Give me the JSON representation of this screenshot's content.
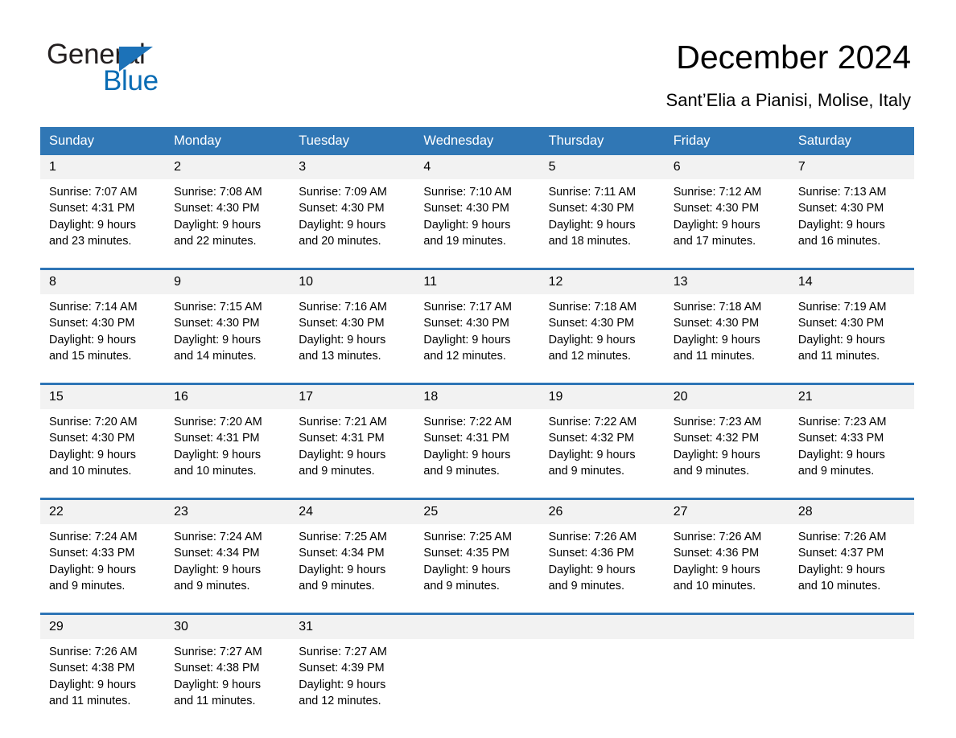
{
  "brand": {
    "name_part1": "General",
    "name_part2": "Blue",
    "accent_color": "#0a6cb4",
    "triangle_color": "#1c72b8"
  },
  "header": {
    "month_title": "December 2024",
    "location": "Sant’Elia a Pianisi, Molise, Italy"
  },
  "calendar": {
    "header_bg": "#3077b5",
    "date_strip_bg": "#f2f2f2",
    "row_divider_color": "#2e75b6",
    "weekday_headers": [
      "Sunday",
      "Monday",
      "Tuesday",
      "Wednesday",
      "Thursday",
      "Friday",
      "Saturday"
    ],
    "weeks": [
      [
        {
          "date": "1",
          "sunrise": "Sunrise: 7:07 AM",
          "sunset": "Sunset: 4:31 PM",
          "daylight_line1": "Daylight: 9 hours",
          "daylight_line2": "and 23 minutes."
        },
        {
          "date": "2",
          "sunrise": "Sunrise: 7:08 AM",
          "sunset": "Sunset: 4:30 PM",
          "daylight_line1": "Daylight: 9 hours",
          "daylight_line2": "and 22 minutes."
        },
        {
          "date": "3",
          "sunrise": "Sunrise: 7:09 AM",
          "sunset": "Sunset: 4:30 PM",
          "daylight_line1": "Daylight: 9 hours",
          "daylight_line2": "and 20 minutes."
        },
        {
          "date": "4",
          "sunrise": "Sunrise: 7:10 AM",
          "sunset": "Sunset: 4:30 PM",
          "daylight_line1": "Daylight: 9 hours",
          "daylight_line2": "and 19 minutes."
        },
        {
          "date": "5",
          "sunrise": "Sunrise: 7:11 AM",
          "sunset": "Sunset: 4:30 PM",
          "daylight_line1": "Daylight: 9 hours",
          "daylight_line2": "and 18 minutes."
        },
        {
          "date": "6",
          "sunrise": "Sunrise: 7:12 AM",
          "sunset": "Sunset: 4:30 PM",
          "daylight_line1": "Daylight: 9 hours",
          "daylight_line2": "and 17 minutes."
        },
        {
          "date": "7",
          "sunrise": "Sunrise: 7:13 AM",
          "sunset": "Sunset: 4:30 PM",
          "daylight_line1": "Daylight: 9 hours",
          "daylight_line2": "and 16 minutes."
        }
      ],
      [
        {
          "date": "8",
          "sunrise": "Sunrise: 7:14 AM",
          "sunset": "Sunset: 4:30 PM",
          "daylight_line1": "Daylight: 9 hours",
          "daylight_line2": "and 15 minutes."
        },
        {
          "date": "9",
          "sunrise": "Sunrise: 7:15 AM",
          "sunset": "Sunset: 4:30 PM",
          "daylight_line1": "Daylight: 9 hours",
          "daylight_line2": "and 14 minutes."
        },
        {
          "date": "10",
          "sunrise": "Sunrise: 7:16 AM",
          "sunset": "Sunset: 4:30 PM",
          "daylight_line1": "Daylight: 9 hours",
          "daylight_line2": "and 13 minutes."
        },
        {
          "date": "11",
          "sunrise": "Sunrise: 7:17 AM",
          "sunset": "Sunset: 4:30 PM",
          "daylight_line1": "Daylight: 9 hours",
          "daylight_line2": "and 12 minutes."
        },
        {
          "date": "12",
          "sunrise": "Sunrise: 7:18 AM",
          "sunset": "Sunset: 4:30 PM",
          "daylight_line1": "Daylight: 9 hours",
          "daylight_line2": "and 12 minutes."
        },
        {
          "date": "13",
          "sunrise": "Sunrise: 7:18 AM",
          "sunset": "Sunset: 4:30 PM",
          "daylight_line1": "Daylight: 9 hours",
          "daylight_line2": "and 11 minutes."
        },
        {
          "date": "14",
          "sunrise": "Sunrise: 7:19 AM",
          "sunset": "Sunset: 4:30 PM",
          "daylight_line1": "Daylight: 9 hours",
          "daylight_line2": "and 11 minutes."
        }
      ],
      [
        {
          "date": "15",
          "sunrise": "Sunrise: 7:20 AM",
          "sunset": "Sunset: 4:30 PM",
          "daylight_line1": "Daylight: 9 hours",
          "daylight_line2": "and 10 minutes."
        },
        {
          "date": "16",
          "sunrise": "Sunrise: 7:20 AM",
          "sunset": "Sunset: 4:31 PM",
          "daylight_line1": "Daylight: 9 hours",
          "daylight_line2": "and 10 minutes."
        },
        {
          "date": "17",
          "sunrise": "Sunrise: 7:21 AM",
          "sunset": "Sunset: 4:31 PM",
          "daylight_line1": "Daylight: 9 hours",
          "daylight_line2": "and 9 minutes."
        },
        {
          "date": "18",
          "sunrise": "Sunrise: 7:22 AM",
          "sunset": "Sunset: 4:31 PM",
          "daylight_line1": "Daylight: 9 hours",
          "daylight_line2": "and 9 minutes."
        },
        {
          "date": "19",
          "sunrise": "Sunrise: 7:22 AM",
          "sunset": "Sunset: 4:32 PM",
          "daylight_line1": "Daylight: 9 hours",
          "daylight_line2": "and 9 minutes."
        },
        {
          "date": "20",
          "sunrise": "Sunrise: 7:23 AM",
          "sunset": "Sunset: 4:32 PM",
          "daylight_line1": "Daylight: 9 hours",
          "daylight_line2": "and 9 minutes."
        },
        {
          "date": "21",
          "sunrise": "Sunrise: 7:23 AM",
          "sunset": "Sunset: 4:33 PM",
          "daylight_line1": "Daylight: 9 hours",
          "daylight_line2": "and 9 minutes."
        }
      ],
      [
        {
          "date": "22",
          "sunrise": "Sunrise: 7:24 AM",
          "sunset": "Sunset: 4:33 PM",
          "daylight_line1": "Daylight: 9 hours",
          "daylight_line2": "and 9 minutes."
        },
        {
          "date": "23",
          "sunrise": "Sunrise: 7:24 AM",
          "sunset": "Sunset: 4:34 PM",
          "daylight_line1": "Daylight: 9 hours",
          "daylight_line2": "and 9 minutes."
        },
        {
          "date": "24",
          "sunrise": "Sunrise: 7:25 AM",
          "sunset": "Sunset: 4:34 PM",
          "daylight_line1": "Daylight: 9 hours",
          "daylight_line2": "and 9 minutes."
        },
        {
          "date": "25",
          "sunrise": "Sunrise: 7:25 AM",
          "sunset": "Sunset: 4:35 PM",
          "daylight_line1": "Daylight: 9 hours",
          "daylight_line2": "and 9 minutes."
        },
        {
          "date": "26",
          "sunrise": "Sunrise: 7:26 AM",
          "sunset": "Sunset: 4:36 PM",
          "daylight_line1": "Daylight: 9 hours",
          "daylight_line2": "and 9 minutes."
        },
        {
          "date": "27",
          "sunrise": "Sunrise: 7:26 AM",
          "sunset": "Sunset: 4:36 PM",
          "daylight_line1": "Daylight: 9 hours",
          "daylight_line2": "and 10 minutes."
        },
        {
          "date": "28",
          "sunrise": "Sunrise: 7:26 AM",
          "sunset": "Sunset: 4:37 PM",
          "daylight_line1": "Daylight: 9 hours",
          "daylight_line2": "and 10 minutes."
        }
      ],
      [
        {
          "date": "29",
          "sunrise": "Sunrise: 7:26 AM",
          "sunset": "Sunset: 4:38 PM",
          "daylight_line1": "Daylight: 9 hours",
          "daylight_line2": "and 11 minutes."
        },
        {
          "date": "30",
          "sunrise": "Sunrise: 7:27 AM",
          "sunset": "Sunset: 4:38 PM",
          "daylight_line1": "Daylight: 9 hours",
          "daylight_line2": "and 11 minutes."
        },
        {
          "date": "31",
          "sunrise": "Sunrise: 7:27 AM",
          "sunset": "Sunset: 4:39 PM",
          "daylight_line1": "Daylight: 9 hours",
          "daylight_line2": "and 12 minutes."
        },
        {
          "date": "",
          "sunrise": "",
          "sunset": "",
          "daylight_line1": "",
          "daylight_line2": ""
        },
        {
          "date": "",
          "sunrise": "",
          "sunset": "",
          "daylight_line1": "",
          "daylight_line2": ""
        },
        {
          "date": "",
          "sunrise": "",
          "sunset": "",
          "daylight_line1": "",
          "daylight_line2": ""
        },
        {
          "date": "",
          "sunrise": "",
          "sunset": "",
          "daylight_line1": "",
          "daylight_line2": ""
        }
      ]
    ]
  }
}
